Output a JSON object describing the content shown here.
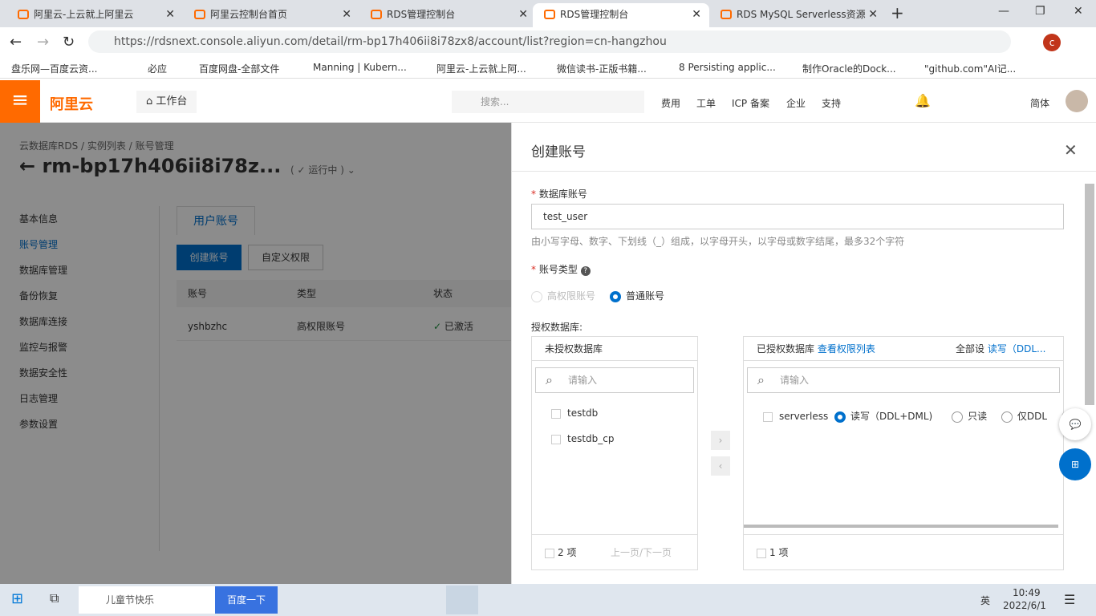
{
  "browser": {
    "tabs": [
      {
        "label": "阿里云-上云就上阿里云"
      },
      {
        "label": "阿里云控制台首页"
      },
      {
        "label": "RDS管理控制台"
      },
      {
        "label": "RDS管理控制台",
        "active": true
      },
      {
        "label": "RDS MySQL Serverless资源"
      }
    ],
    "url": "https://rdsnext.console.aliyun.com/detail/rm-bp17h406ii8i78zx8/account/list?region=cn-hangzhou",
    "profile": "c",
    "bookmarks": [
      "盘乐网—百度云资...",
      "必应",
      "百度网盘-全部文件",
      "Manning | Kubern...",
      "阿里云-上云就上阿...",
      "微信读书-正版书籍...",
      "8 Persisting applic...",
      "制作Oracle的Dock...",
      "\"github.com\"AI记..."
    ]
  },
  "topnav": {
    "logo": "阿里云",
    "workbench": "工作台",
    "search_placeholder": "搜索...",
    "links": [
      "费用",
      "工单",
      "ICP 备案",
      "企业",
      "支持"
    ],
    "lang": "简体"
  },
  "page": {
    "breadcrumb": [
      "云数据库RDS",
      "/",
      "实例列表",
      "/",
      "账号管理"
    ],
    "title": "rm-bp17h406ii8i78z...",
    "status": "运行中",
    "sidebar": [
      "基本信息",
      "账号管理",
      "数据库管理",
      "备份恢复",
      "数据库连接",
      "监控与报警",
      "数据安全性",
      "日志管理",
      "参数设置"
    ],
    "tab": "用户账号",
    "create_btn": "创建账号",
    "custom_btn": "自定义权限",
    "columns": [
      "账号",
      "类型",
      "状态"
    ],
    "rows": [
      {
        "account": "yshbzhc",
        "type": "高权限账号",
        "status": "已激活"
      }
    ]
  },
  "panel": {
    "title": "创建账号",
    "db_account_label": "数据库账号",
    "db_account_value": "test_user",
    "hint": "由小写字母、数字、下划线（_）组成，以字母开头，以字母或数字结尾，最多32个字符",
    "type_label": "账号类型",
    "type_options": [
      "高权限账号",
      "普通账号"
    ],
    "type_selected": "普通账号",
    "auth_label": "授权数据库:",
    "left": {
      "title": "未授权数据库",
      "placeholder": "请输入",
      "items": [
        "testdb",
        "testdb_cp"
      ],
      "count": "2 项",
      "pager": "上一页/下一页"
    },
    "right": {
      "title": "已授权数据库",
      "link": "查看权限列表",
      "setall": "全部设",
      "setall_link": "读写（DDL...",
      "placeholder": "请输入",
      "items": [
        {
          "name": "serverless",
          "perms": [
            "读写（DDL+DML)",
            "只读",
            "仅DDL"
          ],
          "selected": "读写（DDL+DML)"
        }
      ],
      "count": "1 项"
    }
  },
  "taskbar": {
    "search": "儿童节快乐",
    "search_btn": "百度一下",
    "ime": "英",
    "time": "10:49",
    "date": "2022/6/1"
  }
}
